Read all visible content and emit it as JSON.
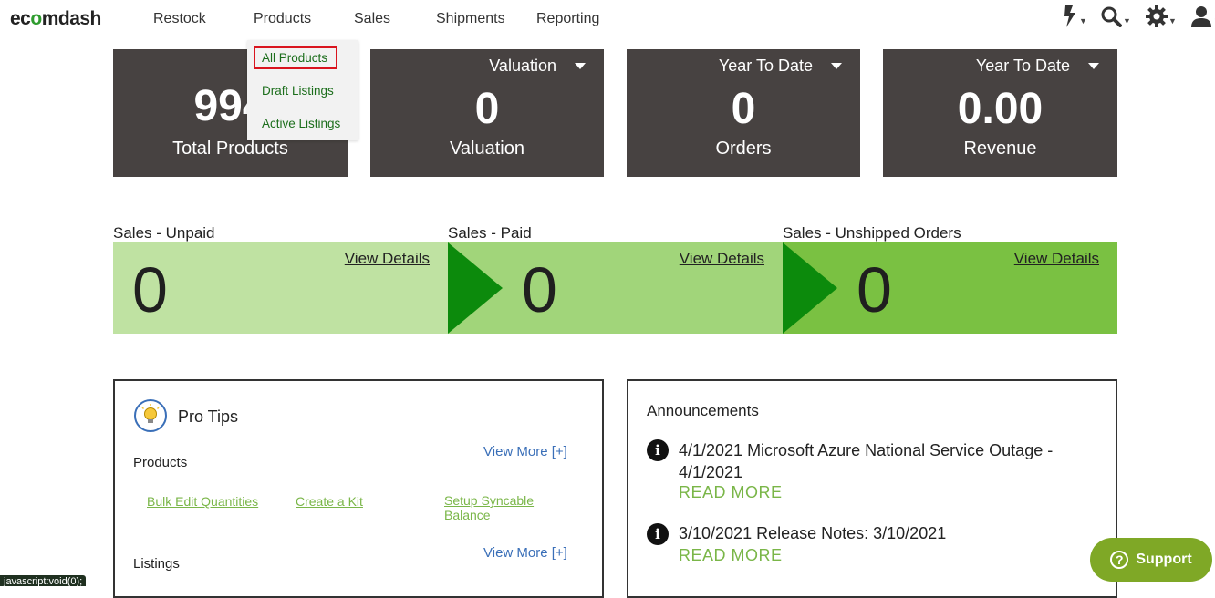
{
  "brand": {
    "logo_prefix": "ec",
    "logo_o": "o",
    "logo_suffix": "mdash"
  },
  "nav": {
    "items": [
      "Restock",
      "Products",
      "Sales",
      "Shipments",
      "Reporting"
    ]
  },
  "products_menu": {
    "items": [
      "All Products",
      "Draft Listings",
      "Active Listings"
    ],
    "selected": "All Products"
  },
  "tools": [
    "lightning-icon",
    "search-icon",
    "gear-icon",
    "user-icon"
  ],
  "tiles": [
    {
      "value": "994",
      "label": "Total Products",
      "selector": ""
    },
    {
      "value": "0",
      "label": "Valuation",
      "selector": "Valuation"
    },
    {
      "value": "0",
      "label": "Orders",
      "selector": "Year To Date"
    },
    {
      "value": "0.00",
      "label": "Revenue",
      "selector": "Year To Date"
    }
  ],
  "sales": [
    {
      "title": "Sales - Unpaid",
      "count": "0",
      "link": "View Details",
      "color": "#bfe2a2"
    },
    {
      "title": "Sales - Paid",
      "count": "0",
      "link": "View Details",
      "color": "#a1d57a"
    },
    {
      "title": "Sales - Unshipped Orders",
      "count": "0",
      "link": "View Details",
      "color": "#7ac142"
    }
  ],
  "pro_tips": {
    "title": "Pro Tips",
    "sections": [
      {
        "heading": "Products",
        "more": "View More [+]",
        "links": [
          "Bulk Edit Quantities",
          "Create a Kit",
          "Setup Syncable Balance"
        ]
      },
      {
        "heading": "Listings",
        "more": "View More [+]"
      }
    ]
  },
  "announcements": {
    "title": "Announcements",
    "items": [
      {
        "text": "4/1/2021 Microsoft Azure National Service Outage - 4/1/2021",
        "more": "READ MORE"
      },
      {
        "text": "3/10/2021 Release Notes: 3/10/2021",
        "more": "READ MORE"
      }
    ]
  },
  "status_bar": "javascript:void(0);",
  "support": {
    "label": "Support"
  },
  "colors": {
    "tile_bg": "#474241",
    "arrow": "#0c8a0c",
    "link_green": "#7ab648",
    "link_blue": "#3a6fb8",
    "highlight": "#d9141e"
  }
}
